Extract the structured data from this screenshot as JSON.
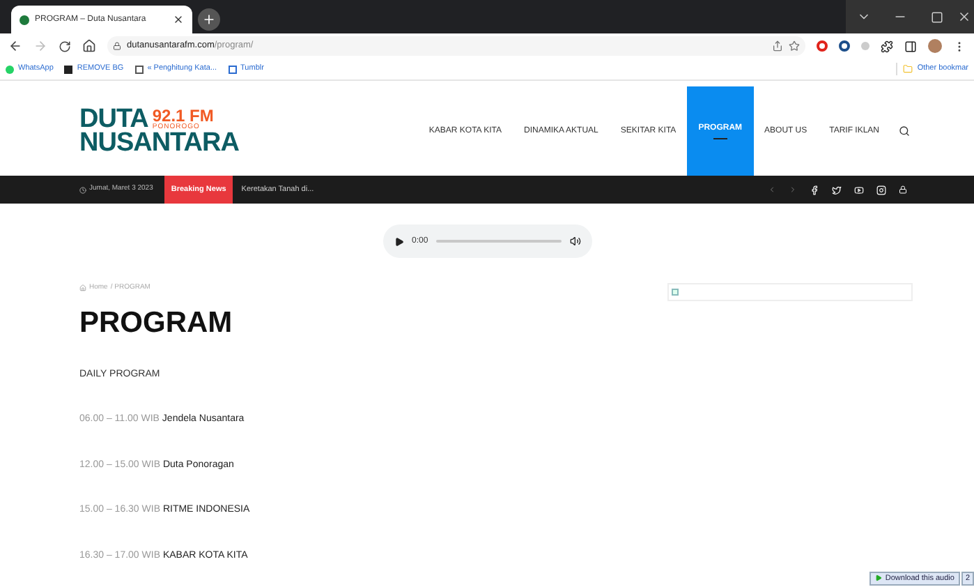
{
  "browser": {
    "tab_title": "PROGRAM – Duta Nusantara",
    "url_host": "dutanusantarafm.com",
    "url_path": "/program/",
    "bookmarks": [
      "WhatsApp",
      "REMOVE BG",
      "« Penghitung Kata...",
      "Tumblr"
    ],
    "other_bookmarks": "Other bookmar"
  },
  "site": {
    "logo_word_1": "DUTA",
    "logo_freq": "92.1 FM",
    "logo_city": "PONOROGO",
    "logo_word_2": "NUSANTARA",
    "nav": [
      {
        "label": "KABAR KOTA KITA",
        "selected": false
      },
      {
        "label": "DINAMIKA AKTUAL",
        "selected": false
      },
      {
        "label": "SEKITAR KITA",
        "selected": false
      },
      {
        "label": "PROGRAM",
        "selected": true
      },
      {
        "label": "ABOUT US",
        "selected": false
      },
      {
        "label": "TARIF IKLAN",
        "selected": false
      }
    ],
    "date": "Jumat, Maret 3 2023",
    "breaking_label": "Breaking News",
    "breaking_text": "Keretakan Tanah di..."
  },
  "player": {
    "time": "0:00",
    "level": 0
  },
  "breadcrumb": {
    "home": "Home",
    "separator": "/",
    "current": "PROGRAM"
  },
  "heading": "PROGRAM",
  "section": "DAILY PROGRAM",
  "schedule": [
    {
      "time": "06.00 – 11.00 WIB",
      "show": "Jendela Nusantara"
    },
    {
      "time": "12.00 – 15.00 WIB",
      "show": "Duta Ponoragan"
    },
    {
      "time": "15.00 – 16.30 WIB",
      "show": "RITME INDONESIA"
    },
    {
      "time": "16.30 – 17.00 WIB",
      "show": "KABAR KOTA KITA"
    }
  ],
  "download": {
    "label": "Download this audio",
    "count": "2"
  }
}
